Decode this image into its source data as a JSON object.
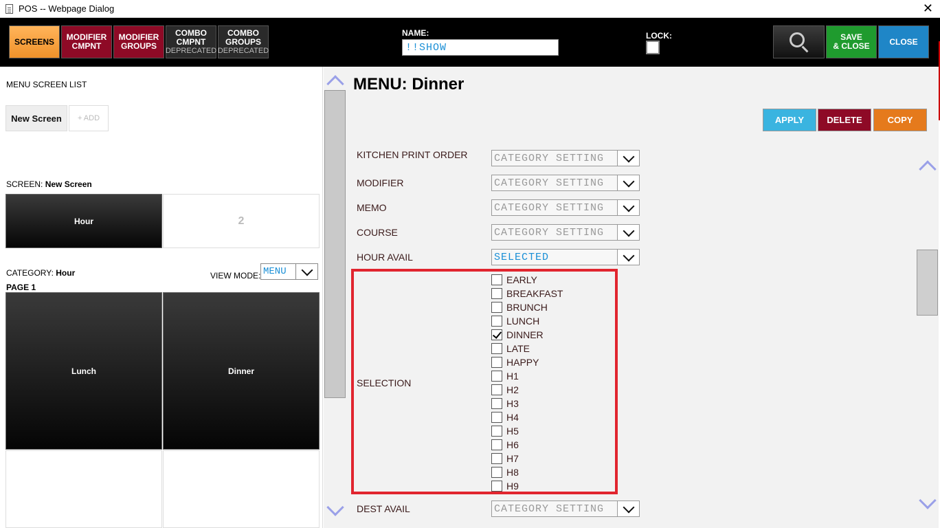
{
  "window": {
    "title": "POS -- Webpage Dialog",
    "close_glyph": "✕"
  },
  "toolbar": {
    "screens": "SCREENS",
    "modifier_cmpnt": [
      "MODIFIER",
      "CMPNT"
    ],
    "modifier_groups": [
      "MODIFIER",
      "GROUPS"
    ],
    "combo_cmpnt": [
      "COMBO",
      "CMPNT",
      "DEPRECATED"
    ],
    "combo_groups": [
      "COMBO",
      "GROUPS",
      "DEPRECATED"
    ],
    "name_label": "NAME:",
    "name_value": "!!SHOW",
    "lock_label": "LOCK:",
    "save_close": [
      "SAVE",
      "& CLOSE"
    ],
    "close": "CLOSE"
  },
  "left": {
    "menu_screen_list": "MENU SCREEN LIST",
    "new_screen": "New Screen",
    "add": "+ ADD",
    "screen_prefix": "SCREEN: ",
    "screen_name": "New Screen",
    "screen_tiles": [
      "Hour",
      "2"
    ],
    "category_prefix": "CATEGORY: ",
    "category_name": "Hour",
    "view_mode_label": "VIEW MODE:",
    "view_mode_value": "MENU",
    "page_label": "PAGE 1",
    "category_tiles": [
      "Lunch",
      "Dinner"
    ]
  },
  "right": {
    "menu_title": "MENU: Dinner",
    "apply": "APPLY",
    "delete": "DELETE",
    "copy": "COPY",
    "fields": [
      {
        "label": "KITCHEN PRINT ORDER",
        "value": "CATEGORY SETTING"
      },
      {
        "label": "MODIFIER",
        "value": "CATEGORY SETTING"
      },
      {
        "label": "MEMO",
        "value": "CATEGORY SETTING"
      },
      {
        "label": "COURSE",
        "value": "CATEGORY SETTING"
      },
      {
        "label": "HOUR AVAIL",
        "value": "SELECTED"
      }
    ],
    "selection_label": "SELECTION",
    "selection_options": [
      {
        "label": "EARLY",
        "checked": false
      },
      {
        "label": "BREAKFAST",
        "checked": false
      },
      {
        "label": "BRUNCH",
        "checked": false
      },
      {
        "label": "LUNCH",
        "checked": false
      },
      {
        "label": "DINNER",
        "checked": true
      },
      {
        "label": "LATE",
        "checked": false
      },
      {
        "label": "HAPPY",
        "checked": false
      },
      {
        "label": "H1",
        "checked": false
      },
      {
        "label": "H2",
        "checked": false
      },
      {
        "label": "H3",
        "checked": false
      },
      {
        "label": "H4",
        "checked": false
      },
      {
        "label": "H5",
        "checked": false
      },
      {
        "label": "H6",
        "checked": false
      },
      {
        "label": "H7",
        "checked": false
      },
      {
        "label": "H8",
        "checked": false
      },
      {
        "label": "H9",
        "checked": false
      }
    ],
    "dest_avail": {
      "label": "DEST AVAIL",
      "value": "CATEGORY SETTING"
    }
  },
  "colors": {
    "accent_orange": "#f0922a",
    "maroon": "#8e0a26",
    "green": "#1f9b2e",
    "blue": "#1f86c7",
    "highlight_red": "#e1252f"
  }
}
